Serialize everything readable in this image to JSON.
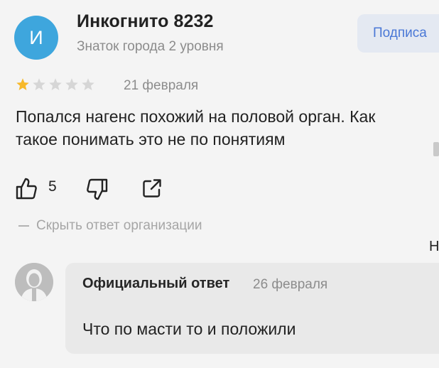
{
  "author": {
    "initial": "И",
    "name": "Инкогнито 8232",
    "level": "Знаток города 2 уровня",
    "avatar_color": "#3ea6dd",
    "subscribe_label": "Подписа"
  },
  "review": {
    "rating": 1,
    "max_rating": 5,
    "date": "21 февраля",
    "text": "Попался нагенс похожий на половой орган. Как\nтакое понимать это не по понятиям",
    "likes": "5"
  },
  "actions": {
    "like_icon": "thumbs-up-icon",
    "dislike_icon": "thumbs-down-icon",
    "share_icon": "share-icon",
    "hide_answer_label": "Скрыть ответ организации"
  },
  "edge_letter": "Н",
  "org_answer": {
    "title": "Официальный ответ",
    "date": "26 февраля",
    "text": "Что по масти то и положили"
  },
  "colors": {
    "star_filled": "#f7b92a",
    "star_empty": "#d6d6d6",
    "subscribe_bg": "#e4e9f2",
    "subscribe_text": "#4a78d6"
  }
}
